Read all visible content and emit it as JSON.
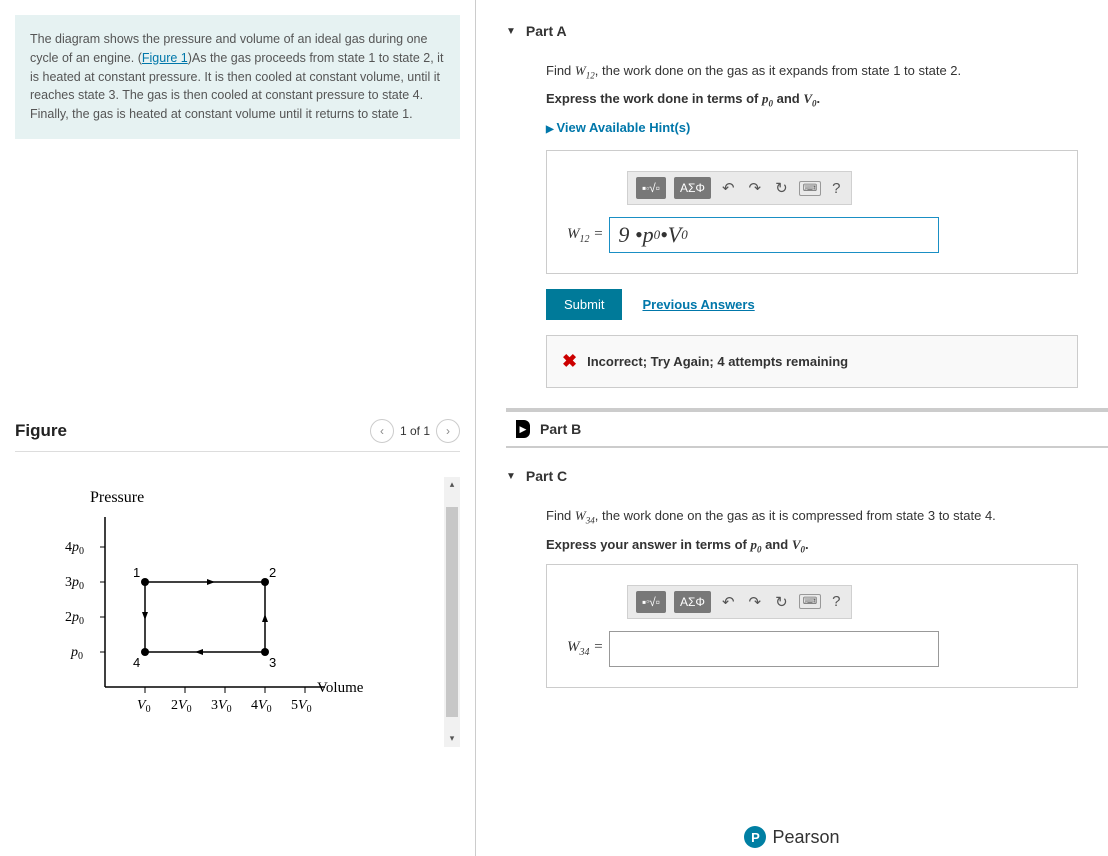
{
  "description": {
    "text1": "The diagram shows the pressure and volume of an ideal gas during one cycle of an engine. (",
    "figlink": "Figure 1",
    "text2": ")As the gas proceeds from state 1 to state 2, it is heated at constant pressure. It is then cooled at constant volume, until it reaches state 3. The gas is then cooled at constant pressure to state 4. Finally, the gas is heated at constant volume until it returns to state 1."
  },
  "figure": {
    "title": "Figure",
    "pager": "1 of 1",
    "ylabel": "Pressure",
    "xlabel": "Volume",
    "y_ticks": [
      "4p₀",
      "3p₀",
      "2p₀",
      "p₀"
    ],
    "x_ticks": [
      "V₀",
      "2V₀",
      "3V₀",
      "4V₀",
      "5V₀"
    ],
    "states": {
      "1": [
        1,
        3
      ],
      "2": [
        4,
        3
      ],
      "3": [
        4,
        1
      ],
      "4": [
        1,
        1
      ]
    }
  },
  "partA": {
    "title": "Part A",
    "prompt_pre": "Find ",
    "prompt_var": "W₁₂",
    "prompt_post": ", the work done on the gas as it expands from state 1 to state 2.",
    "express": "Express the work done in terms of ",
    "exp_v1": "p₀",
    "exp_and": " and ",
    "exp_v2": "V₀",
    "hints": "View Available Hint(s)",
    "answer_label": "W₁₂ =",
    "answer_value": "9 • p₀ • V₀",
    "submit": "Submit",
    "prev": "Previous Answers",
    "feedback": "Incorrect; Try Again; 4 attempts remaining"
  },
  "partB": {
    "title": "Part B"
  },
  "partC": {
    "title": "Part C",
    "prompt_pre": "Find ",
    "prompt_var": "W₃₄",
    "prompt_post": ", the work done on the gas as it is compressed from state 3 to state 4.",
    "express": "Express your answer in terms of ",
    "exp_v1": "p₀",
    "exp_and": " and ",
    "exp_v2": "V₀",
    "answer_label": "W₃₄ ="
  },
  "toolbar": {
    "greek": "ΑΣΦ",
    "help": "?"
  },
  "brand": "Pearson",
  "chart_data": {
    "type": "line",
    "title": "P-V diagram (ideal gas cycle)",
    "xlabel": "Volume (V₀ units)",
    "ylabel": "Pressure (p₀ units)",
    "x": [
      1,
      4,
      4,
      1,
      1
    ],
    "y": [
      3,
      3,
      1,
      1,
      3
    ],
    "annotations": [
      {
        "label": "1",
        "x": 1,
        "y": 3
      },
      {
        "label": "2",
        "x": 4,
        "y": 3
      },
      {
        "label": "3",
        "x": 4,
        "y": 1
      },
      {
        "label": "4",
        "x": 1,
        "y": 1
      }
    ],
    "xlim": [
      0,
      5.5
    ],
    "ylim": [
      0,
      4.5
    ]
  }
}
